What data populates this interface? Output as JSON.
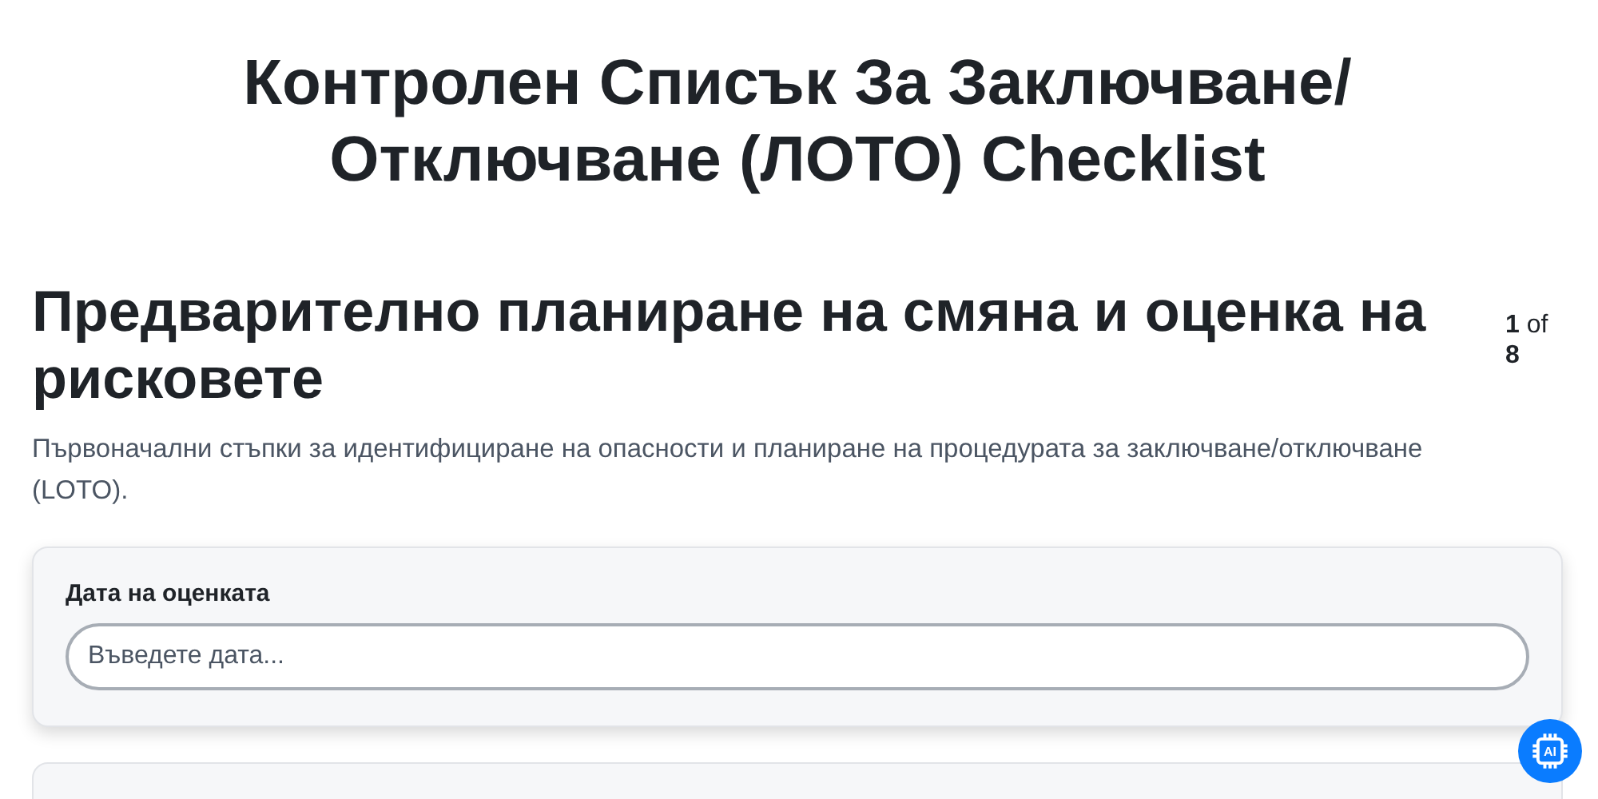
{
  "title": "Контролен Списък За Заключване/ Отключване (ЛОТО) Checklist",
  "section": {
    "heading": "Предварително планиране на смяна и оценка на рисковете",
    "counter": "**1** of **8**",
    "description": "Първоначални стъпки за идентифициране на опасности и планиране на процедурата за заключване/отключване (LOTO)."
  },
  "fields": [
    {
      "label": "Дата на оценката",
      "placeholder": "Въведете дата..."
    }
  ],
  "ai_button": {
    "label": "AI"
  }
}
